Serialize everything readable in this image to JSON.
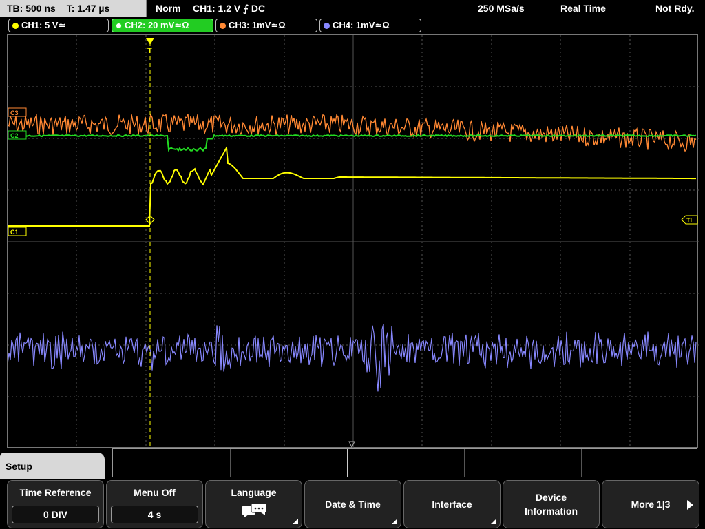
{
  "status": {
    "timebase": "TB: 500 ns",
    "trigger_time": "T: 1.47 µs",
    "acq_mode": "Norm",
    "trigger": "CH1: 1.2 V ⨍ DC",
    "sample_rate": "250 MSa/s",
    "real_time": "Real Time",
    "ready": "Not Rdy."
  },
  "channels": [
    {
      "label": "CH1: 5 V≃",
      "color": "#ffff00",
      "active": false
    },
    {
      "label": "CH2: 20 mV≃Ω",
      "color": "#22dd22",
      "active": true
    },
    {
      "label": "CH3: 1mV≃Ω",
      "color": "#ff8833",
      "active": false
    },
    {
      "label": "CH4: 1mV≃Ω",
      "color": "#8888ff",
      "active": false
    }
  ],
  "markers": {
    "c1": "C1",
    "c2": "C2",
    "c3": "C3",
    "tl": "TL",
    "trigger": "T"
  },
  "menu": {
    "title": "Setup",
    "softkeys": [
      {
        "title": "Time Reference",
        "value": "0 DIV"
      },
      {
        "title": "Menu Off",
        "value": "4 s"
      },
      {
        "title": "Language",
        "icon": "speech-bubbles-icon"
      },
      {
        "title": "Date & Time"
      },
      {
        "title": "Interface"
      },
      {
        "title": "Device Information"
      },
      {
        "title": "More 1|3"
      }
    ]
  },
  "colors": {
    "ch1": "#ffff00",
    "ch2": "#22dd22",
    "ch3": "#ff8833",
    "ch4": "#8888ff",
    "grid": "#555555"
  }
}
